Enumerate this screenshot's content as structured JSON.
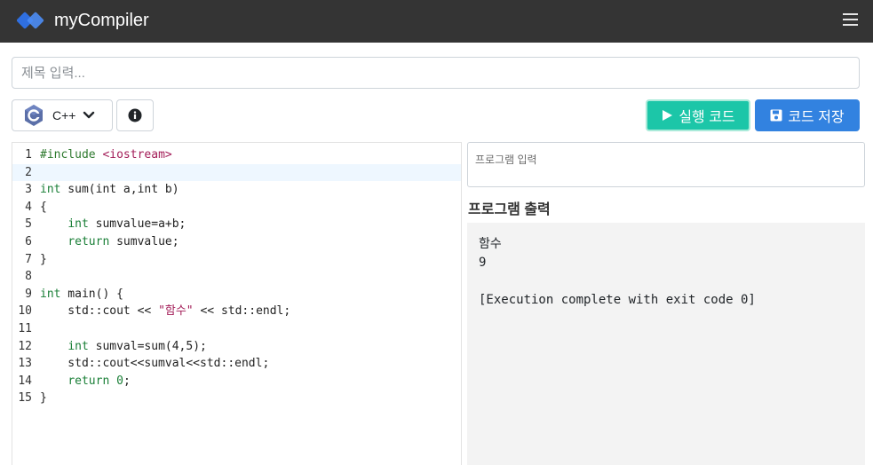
{
  "navbar": {
    "brand": "myCompiler",
    "logo_icon": "mycompiler-logo-icon",
    "menu_icon": "hamburger-menu-icon",
    "background": "#343434"
  },
  "title_input": {
    "placeholder": "제목 입력...",
    "value": ""
  },
  "language": {
    "selected": "C++",
    "icon": "cpp-logo-icon"
  },
  "info_button": {
    "icon": "info-circle-icon"
  },
  "run_button": {
    "label": "실행 코드",
    "icon": "play-icon",
    "color": "#1cc6a8"
  },
  "save_button": {
    "label": "코드 저장",
    "icon": "floppy-disk-icon",
    "color": "#3282e0"
  },
  "editor": {
    "active_line": 2,
    "lines": [
      "#include <iostream>",
      "",
      "int sum(int a,int b)",
      "{",
      "    int sumvalue=a+b;",
      "    return sumvalue;",
      "}",
      "",
      "int main() {",
      "    std::cout << \"함수\" << std::endl;",
      "",
      "    int sumval=sum(4,5);",
      "    std::cout<<sumval<<std::endl;",
      "    return 0;",
      "}"
    ]
  },
  "stdin": {
    "placeholder": "프로그램 입력",
    "value": ""
  },
  "output": {
    "title": "프로그램 출력",
    "lines": [
      "함수",
      "9",
      "",
      "[Execution complete with exit code 0]"
    ]
  }
}
